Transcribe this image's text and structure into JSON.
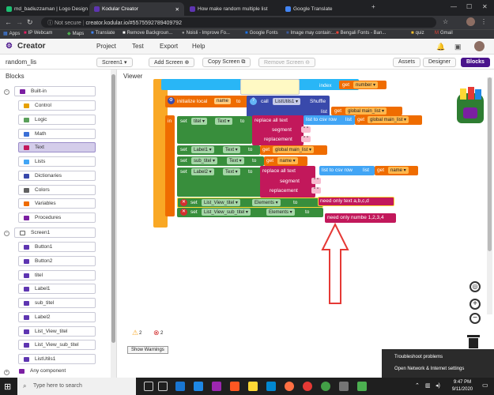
{
  "browser": {
    "tabs": [
      {
        "title": "md_badiuzzaman | Logo Design",
        "active": false
      },
      {
        "title": "Kodular Creator",
        "active": true
      },
      {
        "title": "How make random multiple list",
        "active": false
      },
      {
        "title": "Google Translate",
        "active": false
      }
    ],
    "not_secure": "Not secure",
    "url": "creator.kodular.io/#5575592789409792",
    "bookmarks": [
      "Apps",
      "IP Webcam",
      "Maps",
      "Translate",
      "Remove Backgroun...",
      "Noisli - Improve Fo...",
      "Google Fonts",
      "Image may contain:...",
      "Bengali Fonts - Ban...",
      "quiz",
      "Gmail"
    ]
  },
  "header": {
    "logo": "Creator",
    "menu": [
      "Project",
      "Test",
      "Export",
      "Help"
    ]
  },
  "toolbar": {
    "project": "random_lis",
    "screen": "Screen1 ▾",
    "add_screen": "Add Screen ⊕",
    "copy_screen": "Copy Screen ⧉",
    "remove_screen": "Remove Screen ⊖",
    "assets": "Assets",
    "designer": "Designer",
    "blocks": "Blocks"
  },
  "left": {
    "title": "Blocks",
    "builtin": "Built-in",
    "builtin_items": [
      {
        "label": "Control",
        "color": "#e6a000"
      },
      {
        "label": "Logic",
        "color": "#5aa05a"
      },
      {
        "label": "Math",
        "color": "#3a6fd6"
      },
      {
        "label": "Text",
        "color": "#c2185b"
      },
      {
        "label": "Lists",
        "color": "#42a5f5"
      },
      {
        "label": "Dictionaries",
        "color": "#3949ab"
      },
      {
        "label": "Colors",
        "color": "#616161"
      },
      {
        "label": "Variables",
        "color": "#ef6c00"
      },
      {
        "label": "Procedures",
        "color": "#7b1fa2"
      }
    ],
    "screen": "Screen1",
    "components": [
      "Button1",
      "Button2",
      "titel",
      "Label1",
      "sub_titel",
      "Label2",
      "List_View_titel",
      "List_View_sub_titel",
      "ListUtils1"
    ],
    "any": "Any component"
  },
  "viewer": {
    "title": "Viewer",
    "blocks": {
      "index": "index",
      "get": "get",
      "number": "number ▾",
      "init_local": "initialize local",
      "name": "name",
      "to": "to",
      "call": "call",
      "listutils": "ListUtils1 ▾",
      "shuffle": "Shuffle",
      "list": "list",
      "global_main": "global main_list ▾",
      "in": "in",
      "set": "set",
      "titel": "titel ▾",
      "text": "Text ▾",
      "replace": "replace all text",
      "list_to_csv": "list to csv row",
      "list_kw": "list",
      "segment": "segment",
      "replacement": "replacement",
      "label1": "Label1 ▾",
      "sub_titel": "sub_titel ▾",
      "label2": "Label2 ▾",
      "name_var": "name ▾",
      "lv_titel": "List_View_titel ▾",
      "lv_sub": "List_View_sub_titel ▾",
      "elements": "Elements ▾",
      "need_text": "need only text a,b,c,d",
      "need_num": "need only numbe 1,2,3,4",
      "q": "\" \""
    },
    "warnings": "2",
    "errors": "2",
    "show_warnings": "Show Warnings"
  },
  "popup": {
    "items": [
      "Troubleshoot problems",
      "Open Network & Internet settings"
    ]
  },
  "taskbar": {
    "search": "Type here to search",
    "time": "9:47 PM",
    "date": "9/11/2020"
  }
}
